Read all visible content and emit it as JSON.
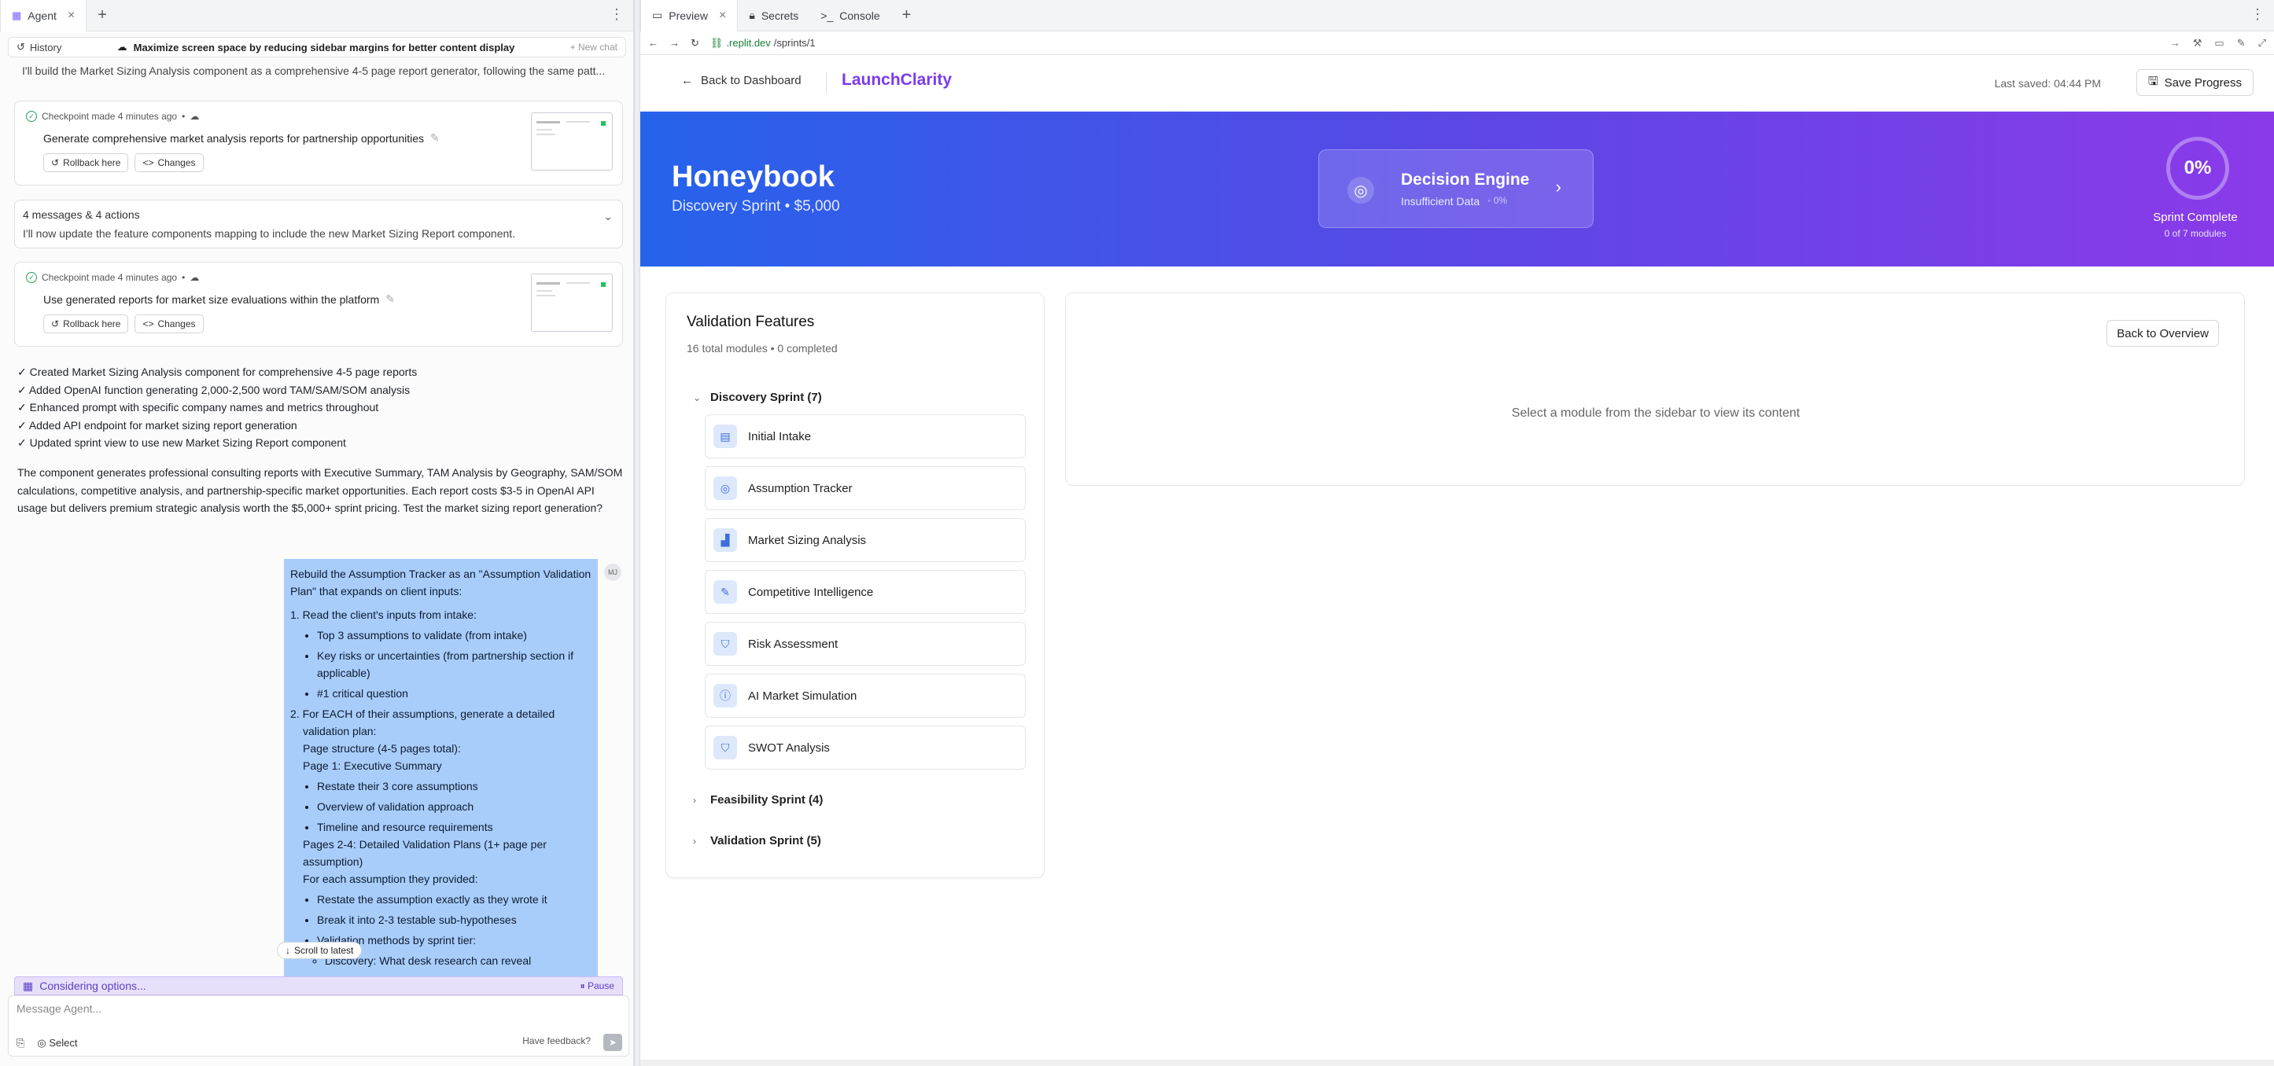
{
  "left_panel": {
    "tabs": [
      {
        "label": "Agent",
        "close": "×"
      }
    ],
    "add_tab": "+",
    "menu": "⋮",
    "history_label": "History",
    "chat_title": "Maximize screen space by reducing sidebar margins for better content display",
    "new_chat": "+ New chat",
    "truncated_line": "I'll build the Market Sizing Analysis component as a comprehensive 4-5 page report generator, following the same patt...",
    "checkpoints": [
      {
        "meta": "Checkpoint made 4 minutes ago",
        "title": "Generate comprehensive market analysis reports for partnership opportunities",
        "rollback": "Rollback here",
        "changes": "Changes"
      },
      {
        "meta": "Checkpoint made 4 minutes ago",
        "title": "Use generated reports for market size evaluations within the platform",
        "rollback": "Rollback here",
        "changes": "Changes"
      }
    ],
    "messages_card": {
      "title": "4 messages & 4 actions",
      "summary": "I'll now update the feature components mapping to include the new Market Sizing Report component."
    },
    "checklist": [
      "✓ Created Market Sizing Analysis component for comprehensive 4-5 page reports",
      "✓ Added OpenAI function generating 2,000-2,500 word TAM/SAM/SOM analysis",
      "✓ Enhanced prompt with specific company names and metrics throughout",
      "✓ Added API endpoint for market sizing report generation",
      "✓ Updated sprint view to use new Market Sizing Report component"
    ],
    "summary_paragraph": "The component generates professional consulting reports with Executive Summary, TAM Analysis by Geography, SAM/SOM calculations, competitive analysis, and partnership-specific market opportunities. Each report costs $3-5 in OpenAI API usage but delivers premium strategic analysis worth the $5,000+ sprint pricing. Test the market sizing report generation?",
    "user_message": {
      "intro": "Rebuild the Assumption Tracker as an \"Assumption Validation Plan\" that expands on client inputs:",
      "step1": "1. Read the client's inputs from intake:",
      "step1_items": [
        "Top 3 assumptions to validate (from intake)",
        "Key risks or uncertainties (from partnership section if applicable)",
        "#1 critical question"
      ],
      "step2": "2. For EACH of their assumptions, generate a detailed validation plan:",
      "page_structure": "Page structure (4-5 pages total):",
      "page1": "Page 1: Executive Summary",
      "page1_items": [
        "Restate their 3 core assumptions",
        "Overview of validation approach",
        "Timeline and resource requirements"
      ],
      "pages24": "Pages 2-4: Detailed Validation Plans (1+ page per assumption)",
      "for_each": "For each assumption they provided:",
      "for_each_items": [
        "Restate the assumption exactly as they wrote it",
        "Break it into 2-3 testable sub-hypotheses",
        "Validation methods by sprint tier:"
      ],
      "sub_items": [
        "Discovery: What desk research can reveal"
      ]
    },
    "avatar_initials": "MJ",
    "scroll_to_latest": "Scroll to latest",
    "status_text": "Considering options...",
    "pause_label": "Pause",
    "composer_placeholder": "Message Agent...",
    "select_label": "Select",
    "feedback_label": "Have feedback?"
  },
  "right_panel": {
    "tabs": [
      {
        "label": "Preview"
      },
      {
        "label": "Secrets"
      },
      {
        "label": "Console"
      }
    ],
    "url_domain": ".replit.dev",
    "url_path": "/sprints/1",
    "back_to_dashboard": "Back to Dashboard",
    "brand": "LaunchClarity",
    "last_saved": "Last saved: 04:44 PM",
    "save_progress": "Save Progress",
    "hero": {
      "client_name": "Honeybook",
      "subtitle": "Discovery Sprint • $5,000",
      "decision_title": "Decision Engine",
      "decision_status": "Insufficient Data",
      "decision_pct": "0%",
      "progress": "0%",
      "progress_fraction": 0,
      "sprint_complete": "Sprint Complete",
      "modules_done": "0 of 7 modules",
      "gradient_colors": [
        "#2563eb",
        "#5b47e6",
        "#8b3ae8"
      ]
    },
    "features": {
      "title": "Validation Features",
      "meta": "16 total modules • 0 completed",
      "groups": [
        {
          "label": "Discovery Sprint (7)",
          "expanded": true
        },
        {
          "label": "Feasibility Sprint (4)",
          "expanded": false
        },
        {
          "label": "Validation Sprint (5)",
          "expanded": false
        }
      ],
      "modules": [
        {
          "label": "Initial Intake",
          "icon": "intake-icon"
        },
        {
          "label": "Assumption Tracker",
          "icon": "target-icon"
        },
        {
          "label": "Market Sizing Analysis",
          "icon": "chart-icon"
        },
        {
          "label": "Competitive Intelligence",
          "icon": "pen-icon"
        },
        {
          "label": "Risk Assessment",
          "icon": "shield-icon"
        },
        {
          "label": "AI Market Simulation",
          "icon": "info-icon"
        },
        {
          "label": "SWOT Analysis",
          "icon": "shield-icon"
        }
      ]
    },
    "content": {
      "back_to_overview": "Back to Overview",
      "empty_message": "Select a module from the sidebar to view its content"
    }
  }
}
